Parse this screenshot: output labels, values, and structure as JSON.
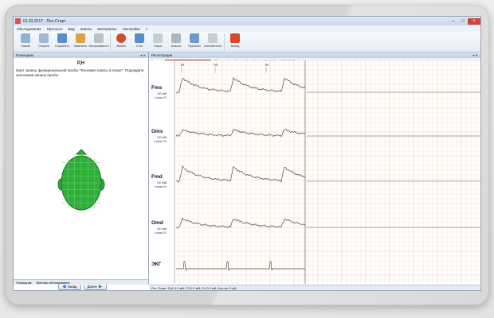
{
  "window": {
    "title": "01.03.2017 - Пес-Старт",
    "controls": [
      "–",
      "□",
      "×"
    ]
  },
  "menu": [
    "Обследование",
    "Протокол",
    "Вид",
    "Запись",
    "Материалы",
    "Настройки",
    "?"
  ],
  "ribbon": [
    {
      "label": "Новый",
      "icon": "new-doc-icon",
      "color": "#8fb4d9"
    },
    {
      "label": "Открыть",
      "icon": "open-icon",
      "color": "#9fb9d4"
    },
    {
      "label": "Сохранить",
      "icon": "save-icon",
      "color": "#5b8ec9"
    },
    {
      "label": "Заменить",
      "icon": "replace-icon",
      "color": "#d9a441"
    },
    {
      "label": "Воспроизвести",
      "icon": "play-icon",
      "color": "#b8c2cd"
    },
    {
      "label": "Запись",
      "icon": "record-icon",
      "color": "#d64a2e"
    },
    {
      "label": "Стоп",
      "icon": "stop-icon",
      "color": "#5b8ec9"
    },
    {
      "label": "Пауза",
      "icon": "pause-icon",
      "color": "#c5ced8"
    },
    {
      "label": "Анализ",
      "icon": "analysis-icon",
      "color": "#aab7c6"
    },
    {
      "label": "Протокол",
      "icon": "protocol-icon",
      "color": "#6e9ad0"
    },
    {
      "label": "Исполнитель",
      "icon": "performer-icon",
      "color": "#c5ced8"
    },
    {
      "label": "Выход",
      "icon": "exit-icon",
      "color": "#d64a2e"
    }
  ],
  "help_panel": {
    "title": "Помощник",
    "code": "P,H",
    "text": "Идет запись функциональной пробы \"Фоновая запись в покое\". Подождите окончания записи пробы.",
    "back_label": "Назад",
    "next_label": "Далее",
    "tabs": [
      "Помощник",
      "Монтаж обследования"
    ]
  },
  "headmap": {
    "fill": "#2fae3a",
    "outline": "#1c6d22",
    "grid": "#6ed36f"
  },
  "chart_panel": {
    "title": "Регистрация",
    "toolbar": [
      "Монтаж",
      "25 мм/с",
      "5 мкВ/мм",
      "0.5 мкВ/мм",
      "ФВЧ 0,5 Гц",
      "ФНЧ 35 Гц"
    ],
    "status": "Рег. Старт: Fp1 0.0 мВ, F3 0.0 мВ, F4 0.0 мВ, Кол-во: 0 мВ"
  },
  "chart_data": {
    "type": "line",
    "channels": [
      {
        "name": "Fms",
        "scale": "100 МкВ",
        "sub": "1 канал 20"
      },
      {
        "name": "Oms",
        "scale": "100 МкВ",
        "sub": "1 канал 20"
      },
      {
        "name": "Fmd",
        "scale": "100 МкВ",
        "sub": "1 канал 20"
      },
      {
        "name": "Omd",
        "scale": "100 МкВ",
        "sub": "1 канал 20"
      },
      {
        "name": "ЭКГ",
        "scale": "",
        "sub": ""
      }
    ],
    "markers": [
      "M",
      "M",
      "M"
    ],
    "grid": true,
    "grid_color": "#f2c9a2"
  }
}
